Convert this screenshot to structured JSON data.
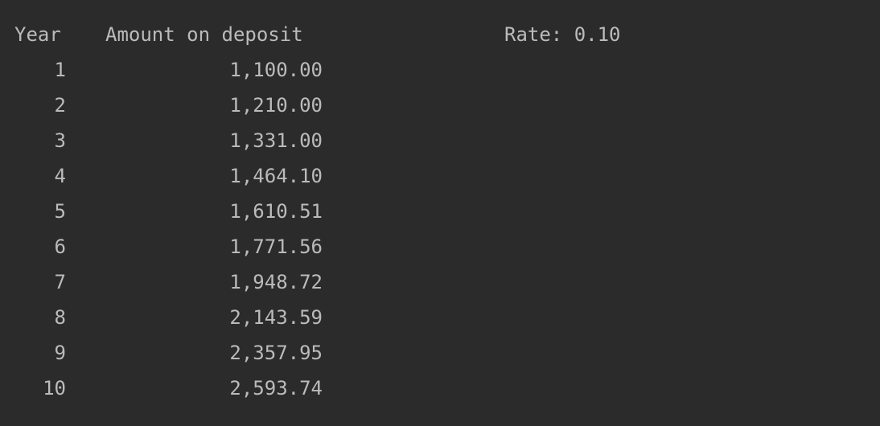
{
  "separator": "----------------------------------------------------------",
  "header": {
    "year": "Year",
    "amount": "Amount on deposit",
    "rate": "Rate: 0.10"
  },
  "rows": [
    {
      "year": "1",
      "amount": "1,100.00"
    },
    {
      "year": "2",
      "amount": "1,210.00"
    },
    {
      "year": "3",
      "amount": "1,331.00"
    },
    {
      "year": "4",
      "amount": "1,464.10"
    },
    {
      "year": "5",
      "amount": "1,610.51"
    },
    {
      "year": "6",
      "amount": "1,771.56"
    },
    {
      "year": "7",
      "amount": "1,948.72"
    },
    {
      "year": "8",
      "amount": "2,143.59"
    },
    {
      "year": "9",
      "amount": "2,357.95"
    },
    {
      "year": "10",
      "amount": "2,593.74"
    }
  ]
}
